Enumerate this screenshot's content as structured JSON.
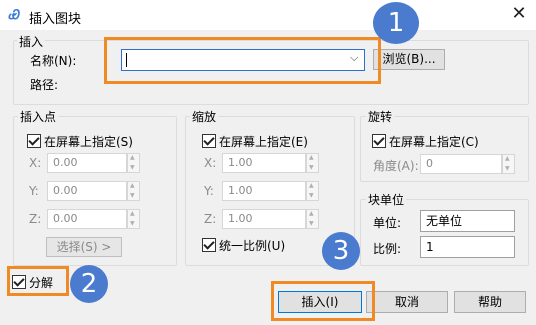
{
  "window": {
    "title": "插入图块",
    "app_icon": "autocad-icon",
    "close_glyph": "✕"
  },
  "insert_group": {
    "legend": "插入",
    "name_label": "名称(N):",
    "name_value": "",
    "browse_label": "浏览(B)...",
    "path_label": "路径:"
  },
  "insertion_point": {
    "legend": "插入点",
    "specify_label": "在屏幕上指定(S)",
    "specify_checked": true,
    "x_label": "X:",
    "x_value": "0.00",
    "y_label": "Y:",
    "y_value": "0.00",
    "z_label": "Z:",
    "z_value": "0.00",
    "select_button": "选择(S) >"
  },
  "scale": {
    "legend": "缩放",
    "specify_label": "在屏幕上指定(E)",
    "specify_checked": true,
    "x_label": "X:",
    "x_value": "1.00",
    "y_label": "Y:",
    "y_value": "1.00",
    "z_label": "Z:",
    "z_value": "1.00",
    "uniform_label": "统一比例(U)",
    "uniform_checked": true
  },
  "rotation": {
    "legend": "旋转",
    "specify_label": "在屏幕上指定(C)",
    "specify_checked": true,
    "angle_label": "角度(A):",
    "angle_value": "0"
  },
  "block_unit": {
    "legend": "块单位",
    "unit_label": "单位:",
    "unit_value": "无单位",
    "ratio_label": "比例:",
    "ratio_value": "1"
  },
  "explode": {
    "label": "分解",
    "checked": true
  },
  "buttons": {
    "ok": "插入(I)",
    "cancel": "取消",
    "help": "帮助"
  },
  "callouts": [
    "1",
    "2",
    "3"
  ],
  "colors": {
    "callout": "#4a7bcf",
    "highlight": "#f08a24"
  }
}
